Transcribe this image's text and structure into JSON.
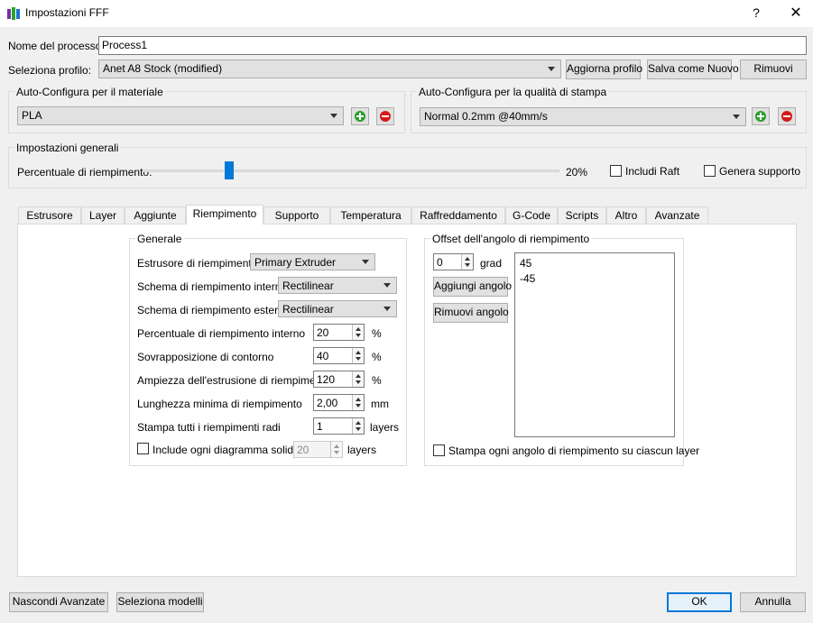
{
  "window": {
    "title": "Impostazioni FFF",
    "help_label": "?",
    "close_label": "✕"
  },
  "process": {
    "name_label": "Nome del processo:",
    "name_value": "Process1"
  },
  "profile": {
    "label": "Seleziona profilo:",
    "value": "Anet A8 Stock (modified)",
    "update_label": "Aggiorna profilo",
    "save_new_label": "Salva come Nuovo",
    "remove_label": "Rimuovi"
  },
  "auto_material": {
    "title": "Auto-Configura per il materiale",
    "value": "PLA"
  },
  "auto_quality": {
    "title": "Auto-Configura per la qualità di stampa",
    "value": "Normal 0.2mm @40mm/s"
  },
  "general": {
    "title": "Impostazioni generali",
    "infill_label": "Percentuale di riempimento:",
    "infill_value": "20%",
    "infill_fraction": 0.2,
    "raft_label": "Includi Raft",
    "raft_checked": false,
    "support_label": "Genera supporto",
    "support_checked": false
  },
  "tabs": [
    {
      "label": "Estrusore",
      "active": false
    },
    {
      "label": "Layer",
      "active": false
    },
    {
      "label": "Aggiunte",
      "active": false
    },
    {
      "label": "Riempimento",
      "active": true
    },
    {
      "label": "Supporto",
      "active": false
    },
    {
      "label": "Temperatura",
      "active": false
    },
    {
      "label": "Raffreddamento",
      "active": false
    },
    {
      "label": "G-Code",
      "active": false
    },
    {
      "label": "Scripts",
      "active": false
    },
    {
      "label": "Altro",
      "active": false
    },
    {
      "label": "Avanzate",
      "active": false
    }
  ],
  "infill_general": {
    "title": "Generale",
    "extruder_label": "Estrusore di riempimento",
    "extruder_value": "Primary Extruder",
    "internal_pattern_label": "Schema di riempimento interno",
    "internal_pattern_value": "Rectilinear",
    "external_pattern_label": "Schema di riempimento esterno",
    "external_pattern_value": "Rectilinear",
    "internal_pct_label": "Percentuale di riempimento interno",
    "internal_pct_value": "20",
    "internal_pct_unit": "%",
    "outline_overlap_label": "Sovrapposizione di contorno",
    "outline_overlap_value": "40",
    "outline_overlap_unit": "%",
    "extrusion_width_label": "Ampiezza dell'estrusione di riempimento",
    "extrusion_width_value": "120",
    "extrusion_width_unit": "%",
    "min_length_label": "Lunghezza minima di riempimento",
    "min_length_value": "2,00",
    "min_length_unit": "mm",
    "sparse_label": "Stampa tutti i riempimenti radi",
    "sparse_value": "1",
    "sparse_unit": "layers",
    "solid_label": "Include ogni diagramma solido",
    "solid_checked": false,
    "solid_value": "20",
    "solid_unit": "layers"
  },
  "angle_offset": {
    "title": "Offset dell'angolo di riempimento",
    "value": "0",
    "unit": "grad",
    "add_label": "Aggiungi angolo",
    "remove_label": "Rimuovi angolo",
    "angles": [
      "45",
      "-45"
    ],
    "print_every_label": "Stampa ogni angolo di riempimento su ciascun layer",
    "print_every_checked": false
  },
  "footer": {
    "hide_advanced_label": "Nascondi Avanzate",
    "select_models_label": "Seleziona modelli",
    "ok_label": "OK",
    "cancel_label": "Annulla"
  }
}
